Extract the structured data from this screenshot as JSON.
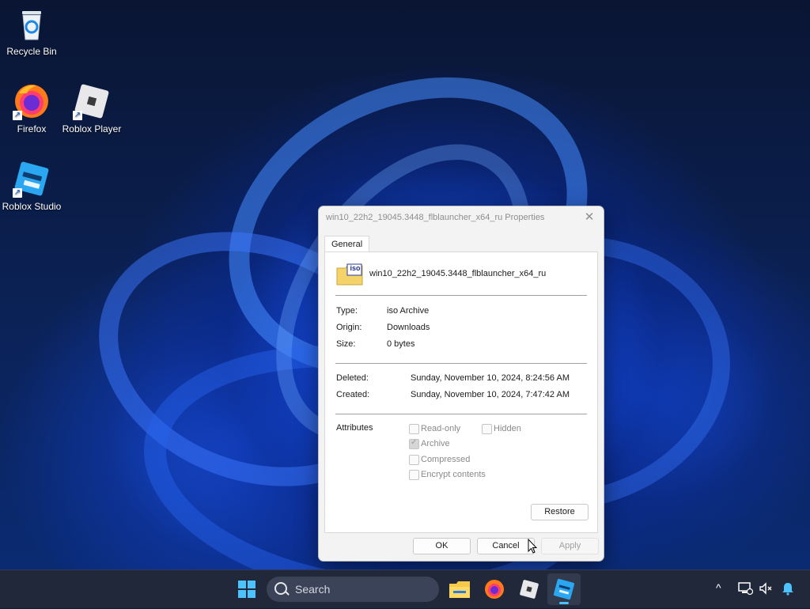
{
  "desktop": {
    "icons": [
      {
        "label": "Recycle Bin"
      },
      {
        "label": "Firefox"
      },
      {
        "label": "Roblox Player"
      },
      {
        "label": "Roblox Studio"
      }
    ]
  },
  "dialog": {
    "title": "win10_22h2_19045.3448_flblauncher_x64_ru Properties",
    "close_glyph": "✕",
    "tab": "General",
    "file_badge": "iso",
    "filename": "win10_22h2_19045.3448_flblauncher_x64_ru",
    "type_label": "Type:",
    "type_value": "iso Archive",
    "origin_label": "Origin:",
    "origin_value": "Downloads",
    "size_label": "Size:",
    "size_value": "0 bytes",
    "deleted_label": "Deleted:",
    "deleted_value": "Sunday, November 10, 2024, 8:24:56 AM",
    "created_label": "Created:",
    "created_value": "Sunday, November 10, 2024, 7:47:42 AM",
    "attributes_label": "Attributes",
    "attributes": {
      "readonly": {
        "label": "Read-only",
        "checked": false
      },
      "hidden": {
        "label": "Hidden",
        "checked": false
      },
      "archive": {
        "label": "Archive",
        "checked": true
      },
      "compressed": {
        "label": "Compressed",
        "checked": false
      },
      "encrypt": {
        "label": "Encrypt contents",
        "checked": false
      }
    },
    "restore_label": "Restore",
    "ok_label": "OK",
    "cancel_label": "Cancel",
    "apply_label": "Apply"
  },
  "taskbar": {
    "search_placeholder": "Search",
    "tray_chevron": "^"
  },
  "colors": {
    "accent": "#1a5fd0",
    "taskbar": "#20283a",
    "dialog_bg": "#f3f3f3"
  }
}
